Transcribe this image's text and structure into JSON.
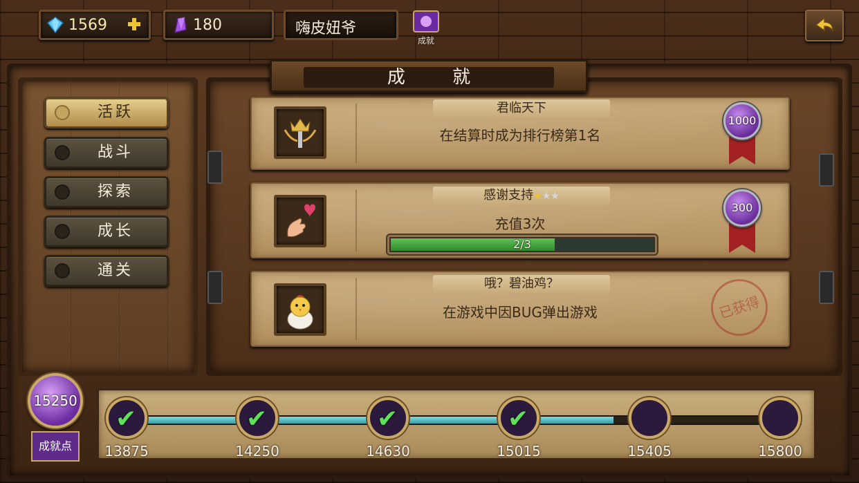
{
  "topbar": {
    "diamonds": "1569",
    "crystals": "180",
    "player_name": "嗨皮妞爷",
    "achievement_label": "成就"
  },
  "page_title": "成 就",
  "sidebar": {
    "items": [
      {
        "label": "活跃",
        "active": true
      },
      {
        "label": "战斗",
        "active": false
      },
      {
        "label": "探索",
        "active": false
      },
      {
        "label": "成长",
        "active": false
      },
      {
        "label": "通关",
        "active": false
      }
    ]
  },
  "achievements": [
    {
      "title": "君临天下",
      "desc": "在结算时成为排行榜第1名",
      "reward": "1000",
      "icon": "crown-sword-icon"
    },
    {
      "title": "感谢支持",
      "desc": "充值3次",
      "reward": "300",
      "progress_text": "2/3",
      "progress": 0.6667,
      "stars_filled": 1,
      "stars_total": 3,
      "icon": "heart-hand-icon"
    },
    {
      "title": "哦？碧油鸡？",
      "desc": "在游戏中因BUG弹出游戏",
      "stamp": "已获得",
      "icon": "chick-egg-icon"
    }
  ],
  "points": {
    "value": "15250",
    "label": "成就点"
  },
  "milestones": [
    {
      "value": "13875",
      "claimed": true,
      "icon": "purple-crystal-icon"
    },
    {
      "value": "14250",
      "claimed": true,
      "icon": "card-icon"
    },
    {
      "value": "14630",
      "claimed": true,
      "icon": "book-icon"
    },
    {
      "value": "15015",
      "claimed": true,
      "icon": "diamond-icon"
    },
    {
      "value": "15405",
      "claimed": false,
      "icon": "chest-book-icon"
    },
    {
      "value": "15800",
      "claimed": false,
      "icon": "purple-crystal-icon"
    }
  ],
  "track_progress": 0.73,
  "colors": {
    "accent_gold": "#c9a868",
    "progress_green": "#5fc055",
    "track_cyan": "#7fdbe0",
    "reward_purple": "#6a2d9c"
  }
}
